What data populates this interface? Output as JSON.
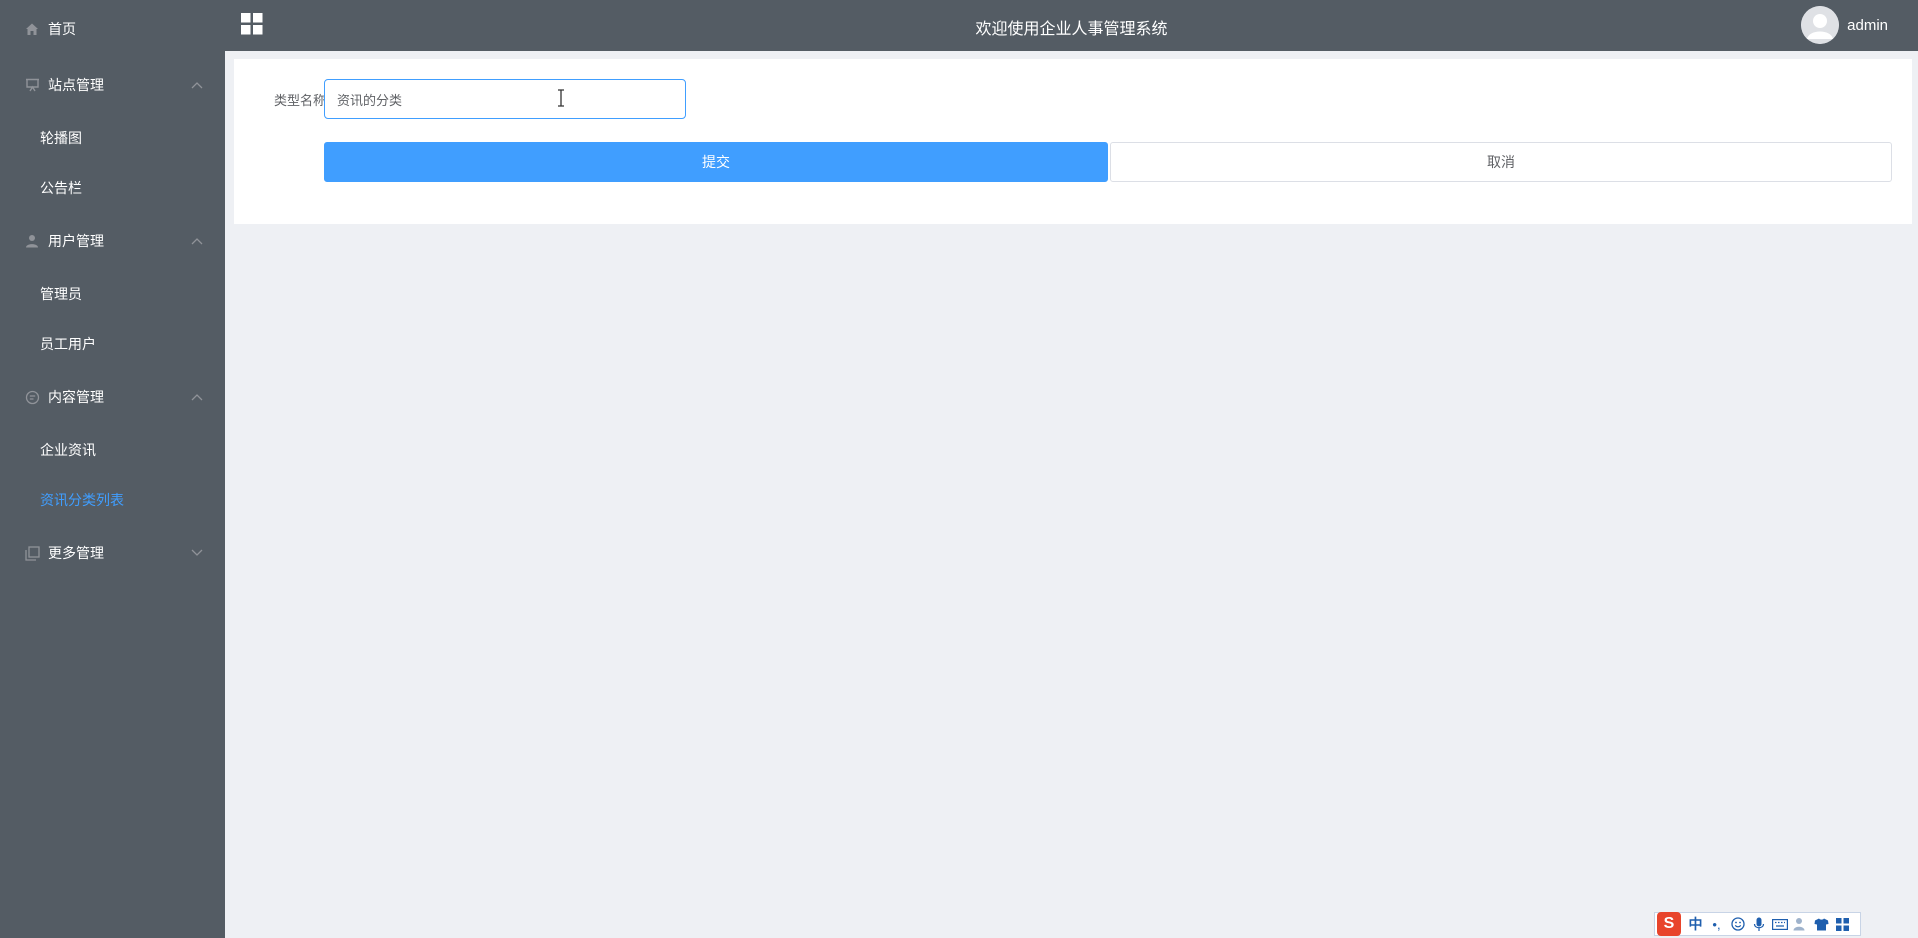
{
  "app": {
    "header_title": "欢迎使用企业人事管理系统",
    "username": "admin"
  },
  "sidebar": {
    "home": "首页",
    "groups": [
      {
        "label": "站点管理",
        "icon": "monitor-icon",
        "expanded": true,
        "children": [
          "轮播图",
          "公告栏"
        ]
      },
      {
        "label": "用户管理",
        "icon": "user-icon",
        "expanded": true,
        "children": [
          "管理员",
          "员工用户"
        ]
      },
      {
        "label": "内容管理",
        "icon": "chat-icon",
        "expanded": true,
        "children": [
          "企业资讯",
          "资讯分类列表"
        ]
      },
      {
        "label": "更多管理",
        "icon": "copy-icon",
        "expanded": false,
        "children": []
      }
    ],
    "active_item": "资讯分类列表"
  },
  "form": {
    "type_name_label": "类型名称",
    "type_name_value": "资讯的分类",
    "submit_label": "提交",
    "cancel_label": "取消"
  },
  "ime": {
    "logo": "S",
    "lang": "中",
    "punct": "•,"
  },
  "colors": {
    "sidebar_bg": "#545c64",
    "accent": "#409eff",
    "page_bg": "#eef0f4"
  }
}
